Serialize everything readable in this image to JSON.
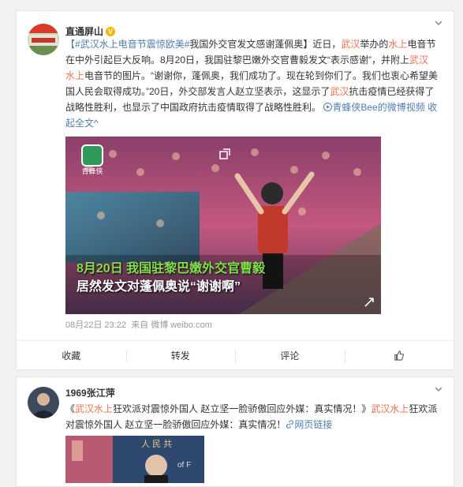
{
  "post1": {
    "author": "直通屏山",
    "verified_badge": "V",
    "text": {
      "topic": "#武汉水上电音节震惊欧美#",
      "p1": "我国外交官发文感谢蓬佩奥】近日，",
      "k1": "武汉",
      "p2": "举办的",
      "k2": "水上",
      "p3": "电音节在中外引起巨大反响。8月20日，我国驻黎巴嫩外交官曹毅发文“表示感谢”，并附上",
      "k3": "武汉",
      "k4": "水上",
      "p4": "电音节的图片。“谢谢你，蓬佩奥，我们成功了。现在轮到你们了。我们也衷心希望美国人民会取得成功。”20日，外交部发言人赵立坚表示，这显示了",
      "k5": "武汉",
      "p5": "抗击疫情已经获得了战略性胜利，也显示了中国政府抗击疫情取得了战略性胜利。",
      "video_link": "青蜂侠Bee的微博视频",
      "collapse": "收起全文"
    },
    "video": {
      "watermark_label": "青蜂侠",
      "caption_line1": "8月20日 我国驻黎巴嫩外交官曹毅",
      "caption_line2": "居然发文对蓬佩奥说“谢谢啊”"
    },
    "timestamp": "08月22日 23:22",
    "source_prefix": "来自",
    "source": "微博 weibo.com",
    "actions": {
      "collect": "收藏",
      "repost": "转发",
      "comment": "评论"
    }
  },
  "post2": {
    "author": "1969张江萍",
    "text": {
      "q1": "《",
      "k1": "武汉水上",
      "p1": "狂欢派对震惊外国人 赵立坚一脸骄傲回应外媒：真实情况！》",
      "k2": "武汉水上",
      "p2": "狂欢派对震惊外国人 赵立坚一脸骄傲回应外媒：真实情况！",
      "link": "网页链接"
    }
  },
  "colors": {
    "highlight": "#eb7350",
    "link": "#507daf",
    "caption_green": "#7ee04a"
  }
}
